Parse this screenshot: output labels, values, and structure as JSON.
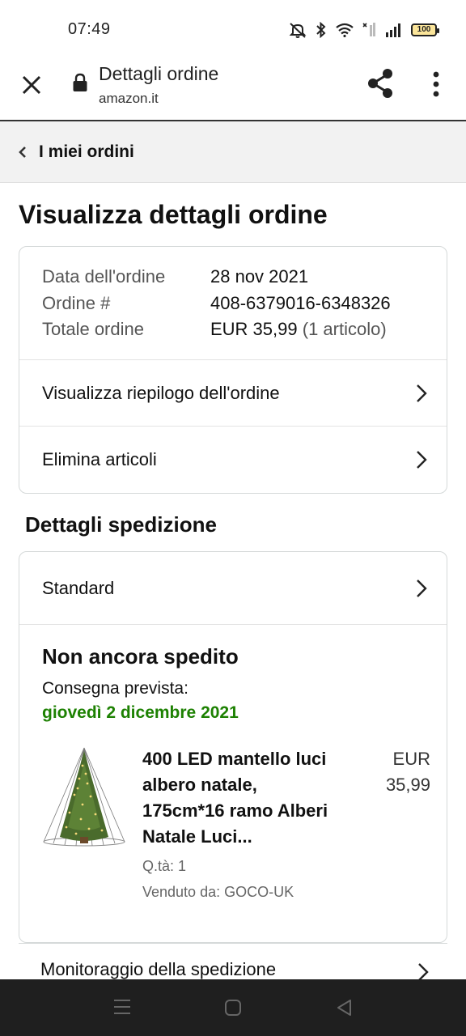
{
  "status_bar": {
    "time": "07:49",
    "battery": "100",
    "icons": [
      "mute-icon",
      "bluetooth-icon",
      "wifi-icon",
      "no-signal-icon",
      "signal-icon",
      "battery-icon"
    ]
  },
  "browser": {
    "title": "Dettagli ordine",
    "domain": "amazon.it",
    "icons": [
      "close-icon",
      "lock-icon",
      "share-icon",
      "more-icon"
    ]
  },
  "back_nav": {
    "label": "I miei ordini"
  },
  "page_title": "Visualizza dettagli ordine",
  "order": {
    "date_label": "Data dell'ordine",
    "date_value": "28 nov 2021",
    "number_label": "Ordine #",
    "number_value": "408-6379016-6348326",
    "total_label": "Totale ordine",
    "total_value": "EUR 35,99",
    "total_items": "(1 articolo)",
    "summary_link": "Visualizza riepilogo dell'ordine",
    "delete_link": "Elimina articoli"
  },
  "shipping": {
    "section_title": "Dettagli spedizione",
    "method": "Standard",
    "status": "Non ancora spedito",
    "delivery_label": "Consegna prevista:",
    "delivery_date": "giovedì 2 dicembre 2021",
    "product": {
      "title": "400 LED mantello luci albero natale, 175cm*16 ramo Alberi Natale Luci...",
      "price_currency": "EUR",
      "price_value": "35,99",
      "quantity": "Q.tà: 1",
      "seller": "Venduto da: GOCO-UK"
    },
    "tracking_link": "Monitoraggio della spedizione"
  },
  "colors": {
    "delivery_green": "#1d8102",
    "back_nav_bg": "#f2f2f2",
    "card_border": "#d5d9d9",
    "system_nav_bg": "#1f1f1f"
  }
}
